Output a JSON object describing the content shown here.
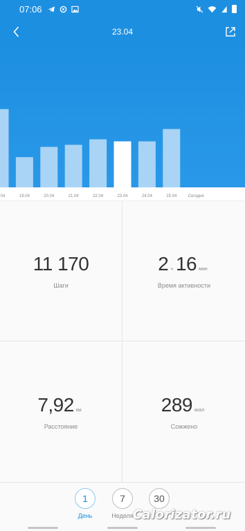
{
  "status_bar": {
    "time": "07:06",
    "left_icons": [
      "telegram-icon",
      "data-saver-icon",
      "image-icon"
    ],
    "right_icons": [
      "mute-icon",
      "wifi-icon",
      "signal-icon",
      "battery-icon"
    ]
  },
  "header": {
    "title": "23.04",
    "back_icon": "chevron-left-icon",
    "share_icon": "share-icon"
  },
  "chart_data": {
    "type": "bar",
    "categories": [
      "04",
      "19.04",
      "20.04",
      "21.04",
      "22.04",
      "23.04",
      "24.04",
      "25.04",
      "Сегодня"
    ],
    "values": [
      11400,
      4400,
      5900,
      6200,
      7000,
      6700,
      6700,
      8500,
      0
    ],
    "selected": "23.04"
  },
  "metrics": {
    "steps": {
      "value": "11 170",
      "label": "Шаги"
    },
    "active_time": {
      "hours": "2",
      "hours_unit": "ч",
      "minutes": "16",
      "minutes_unit": "мин",
      "label": "Время активности"
    },
    "distance": {
      "value": "7,92",
      "unit": "км",
      "label": "Расстояние"
    },
    "calories": {
      "value": "289",
      "unit": "ккал",
      "label": "Сожжено"
    }
  },
  "tabs": [
    {
      "number": "1",
      "label": "День",
      "active": true
    },
    {
      "number": "7",
      "label": "Неделя",
      "active": false
    },
    {
      "number": "30",
      "label": "",
      "active": false
    }
  ],
  "watermark": "Calorizator.ru",
  "colors": {
    "accent": "#1d8fe1",
    "bar": "#a9d4f5",
    "bar_selected": "#ffffff"
  }
}
